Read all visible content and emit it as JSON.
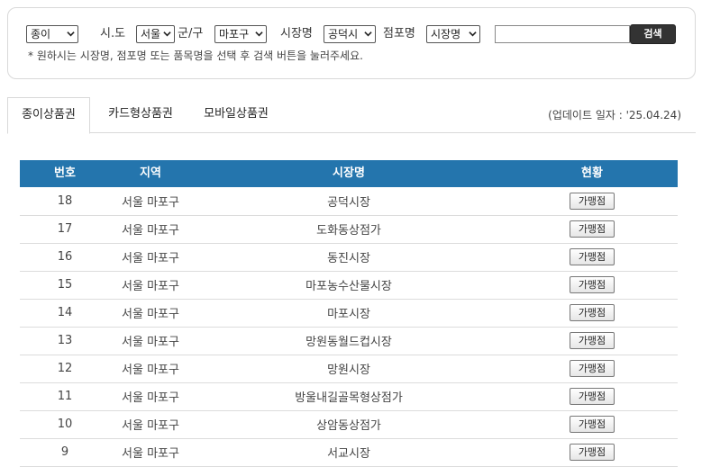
{
  "search": {
    "type_value": "종이",
    "sido_label": "시.도",
    "sido_value": "서울",
    "gungu_label": "군/구",
    "gungu_value": "마포구",
    "market_label": "시장명",
    "market_value": "공덕시",
    "store_label": "점포명",
    "store_value": "시장명",
    "keyword_value": "",
    "search_button": "검색",
    "hint": "* 원하시는 시장명, 점포명 또는 품목명을 선택 후 검색 버튼을 눌러주세요."
  },
  "tabs": [
    {
      "label": "종이상품권",
      "active": true
    },
    {
      "label": "카드형상품권",
      "active": false
    },
    {
      "label": "모바일상품권",
      "active": false
    }
  ],
  "update_text": "(업데이트 일자 : '25.04.24)",
  "table": {
    "headers": [
      "번호",
      "지역",
      "시장명",
      "현황"
    ],
    "rows": [
      {
        "no": "18",
        "region": "서울 마포구",
        "market": "공덕시장",
        "status": "가맹점"
      },
      {
        "no": "17",
        "region": "서울 마포구",
        "market": "도화동상점가",
        "status": "가맹점"
      },
      {
        "no": "16",
        "region": "서울 마포구",
        "market": "동진시장",
        "status": "가맹점"
      },
      {
        "no": "15",
        "region": "서울 마포구",
        "market": "마포농수산물시장",
        "status": "가맹점"
      },
      {
        "no": "14",
        "region": "서울 마포구",
        "market": "마포시장",
        "status": "가맹점"
      },
      {
        "no": "13",
        "region": "서울 마포구",
        "market": "망원동월드컵시장",
        "status": "가맹점"
      },
      {
        "no": "12",
        "region": "서울 마포구",
        "market": "망원시장",
        "status": "가맹점"
      },
      {
        "no": "11",
        "region": "서울 마포구",
        "market": "방울내길골목형상점가",
        "status": "가맹점"
      },
      {
        "no": "10",
        "region": "서울 마포구",
        "market": "상암동상점가",
        "status": "가맹점"
      },
      {
        "no": "9",
        "region": "서울 마포구",
        "market": "서교시장",
        "status": "가맹점"
      }
    ]
  },
  "colors": {
    "header_bg": "#2475ad",
    "search_button_bg": "#333333"
  }
}
